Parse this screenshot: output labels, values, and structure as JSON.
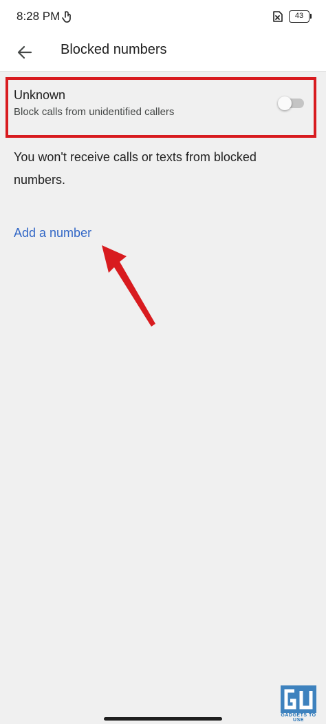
{
  "status_bar": {
    "time": "8:28 PM",
    "battery": "43",
    "icons": [
      "hand-gesture-icon",
      "sim-blocked-icon",
      "battery-icon"
    ]
  },
  "app_bar": {
    "title": "Blocked numbers",
    "back_icon": "arrow-back-icon"
  },
  "unknown_setting": {
    "title": "Unknown",
    "subtitle": "Block calls from unidentified callers",
    "enabled": false
  },
  "info_text": "You won't receive calls or texts from blocked numbers.",
  "add_number_label": "Add a number",
  "watermark": {
    "logo": "GU",
    "text": "GADGETS TO USE"
  },
  "colors": {
    "background": "#f0f0f0",
    "link": "#3267c6",
    "highlight": "#d81b1f",
    "toggle_track": "#c4c4c4"
  }
}
